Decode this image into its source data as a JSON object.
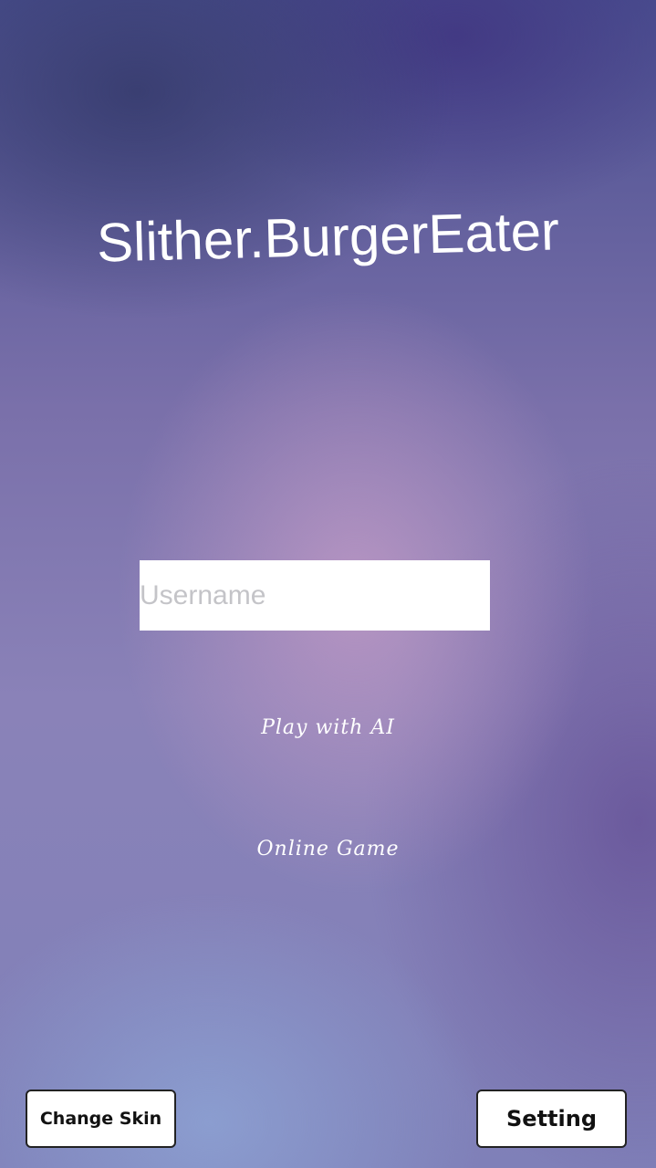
{
  "title": "Slither.BurgerEater",
  "username": {
    "placeholder": "Username",
    "value": ""
  },
  "menu": {
    "play_ai": "Play with AI",
    "online": "Online Game"
  },
  "buttons": {
    "change_skin": "Change Skin",
    "setting": "Setting"
  }
}
